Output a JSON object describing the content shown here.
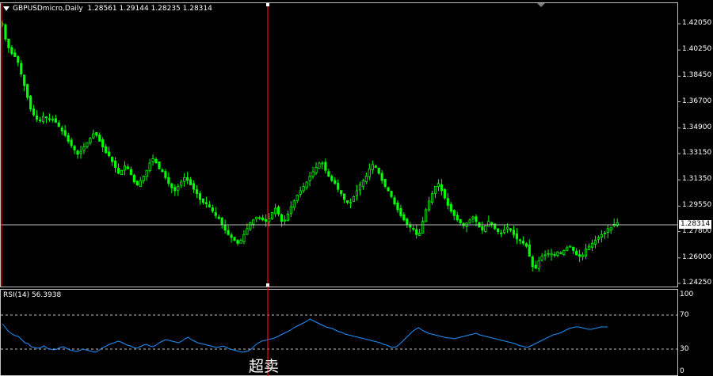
{
  "header": {
    "symbol": "GBPUSDmicro,Daily",
    "ohlc": "1.28561 1.29144 1.28235 1.28314"
  },
  "price_axis": {
    "labels": [
      "1.42050",
      "1.40250",
      "1.38450",
      "1.36700",
      "1.34900",
      "1.33150",
      "1.31350",
      "1.29550",
      "1.27800",
      "1.26000",
      "1.24250"
    ],
    "current_price": "1.28314"
  },
  "rsi": {
    "title": "RSI(14) 56.3938",
    "levels": [
      "100",
      "70",
      "30",
      "0"
    ]
  },
  "annotation": "超卖",
  "colors": {
    "candle": "#00ff00",
    "rsi_line": "#1e90ff",
    "marker_line": "#ff0000",
    "grid": "#c0c0c0",
    "background": "#000000"
  },
  "chart_data": {
    "type": "candlestick",
    "ylim": [
      1.2425,
      1.4205
    ],
    "rsi_ylim": [
      0,
      100
    ],
    "current_price": 1.28314,
    "marker_index": 75,
    "close": [
      1.4205,
      1.41,
      1.404,
      1.4,
      1.398,
      1.394,
      1.386,
      1.378,
      1.37,
      1.362,
      1.358,
      1.355,
      1.354,
      1.357,
      1.356,
      1.355,
      1.355,
      1.353,
      1.35,
      1.347,
      1.344,
      1.34,
      1.337,
      1.334,
      1.331,
      1.333,
      1.336,
      1.339,
      1.342,
      1.345,
      1.344,
      1.34,
      1.336,
      1.332,
      1.33,
      1.326,
      1.322,
      1.318,
      1.32,
      1.323,
      1.321,
      1.317,
      1.312,
      1.31,
      1.313,
      1.316,
      1.32,
      1.325,
      1.328,
      1.325,
      1.321,
      1.319,
      1.315,
      1.311,
      1.308,
      1.306,
      1.309,
      1.312,
      1.315,
      1.313,
      1.31,
      1.307,
      1.304,
      1.3,
      1.298,
      1.297,
      1.295,
      1.292,
      1.289,
      1.287,
      1.283,
      1.279,
      1.276,
      1.274,
      1.272,
      1.27,
      1.272,
      1.276,
      1.28,
      1.284,
      1.286,
      1.288,
      1.287,
      1.286,
      1.285,
      1.287,
      1.291,
      1.294,
      1.29,
      1.285,
      1.286,
      1.29,
      1.295,
      1.299,
      1.303,
      1.306,
      1.309,
      1.312,
      1.316,
      1.319,
      1.322,
      1.325,
      1.325,
      1.32,
      1.316,
      1.313,
      1.311,
      1.307,
      1.304,
      1.3,
      1.298,
      1.298,
      1.302,
      1.306,
      1.31,
      1.313,
      1.316,
      1.321,
      1.324,
      1.322,
      1.318,
      1.313,
      1.309,
      1.306,
      1.302,
      1.297,
      1.293,
      1.289,
      1.286,
      1.283,
      1.281,
      1.28,
      1.276,
      1.277,
      1.285,
      1.293,
      1.299,
      1.304,
      1.309,
      1.311,
      1.306,
      1.301,
      1.296,
      1.292,
      1.289,
      1.286,
      1.284,
      1.282,
      1.284,
      1.286,
      1.288,
      1.285,
      1.281,
      1.279,
      1.282,
      1.285,
      1.283,
      1.28,
      1.278,
      1.277,
      1.279,
      1.281,
      1.279,
      1.276,
      1.273,
      1.272,
      1.27,
      1.268,
      1.261,
      1.254,
      1.253,
      1.258,
      1.261,
      1.262,
      1.263,
      1.263,
      1.262,
      1.264,
      1.263,
      1.265,
      1.267,
      1.268,
      1.265,
      1.262,
      1.261,
      1.262,
      1.266,
      1.268,
      1.27,
      1.272,
      1.274,
      1.276,
      1.277,
      1.28,
      1.281,
      1.283,
      1.284
    ],
    "rsi": [
      60,
      55,
      50,
      47,
      45,
      44,
      40,
      36,
      35,
      31,
      30,
      29,
      30,
      32,
      29,
      28,
      27,
      28,
      30,
      31,
      29,
      27,
      26,
      25,
      26,
      28,
      27,
      26,
      25,
      24,
      26,
      29,
      31,
      33,
      35,
      36,
      38,
      37,
      35,
      33,
      32,
      30,
      29,
      31,
      33,
      34,
      32,
      31,
      33,
      36,
      38,
      40,
      39,
      38,
      37,
      36,
      38,
      41,
      43,
      40,
      38,
      36,
      35,
      34,
      33,
      32,
      31,
      30,
      31,
      32,
      30,
      28,
      27,
      26,
      25,
      24,
      25,
      26,
      29,
      33,
      36,
      38,
      39,
      40,
      41,
      42,
      44,
      46,
      48,
      50,
      52,
      55,
      57,
      59,
      61,
      63,
      66,
      64,
      62,
      60,
      58,
      56,
      55,
      54,
      52,
      50,
      49,
      47,
      46,
      45,
      44,
      43,
      42,
      41,
      40,
      39,
      38,
      37,
      36,
      34,
      33,
      31,
      30,
      31,
      34,
      38,
      42,
      46,
      50,
      53,
      55,
      52,
      50,
      48,
      47,
      46,
      45,
      44,
      43,
      42,
      42,
      41,
      42,
      43,
      44,
      45,
      46,
      47,
      48,
      46,
      45,
      44,
      43,
      42,
      41,
      40,
      39,
      38,
      37,
      36,
      35,
      33,
      32,
      31,
      30,
      32,
      34,
      36,
      38,
      40,
      42,
      44,
      46,
      47,
      48,
      50,
      52,
      54,
      55,
      56,
      56,
      55,
      54,
      53,
      53,
      54,
      55,
      56,
      56,
      56
    ],
    "ohlc_last": {
      "open": 1.28561,
      "high": 1.29144,
      "low": 1.28235,
      "close": 1.28314
    }
  }
}
